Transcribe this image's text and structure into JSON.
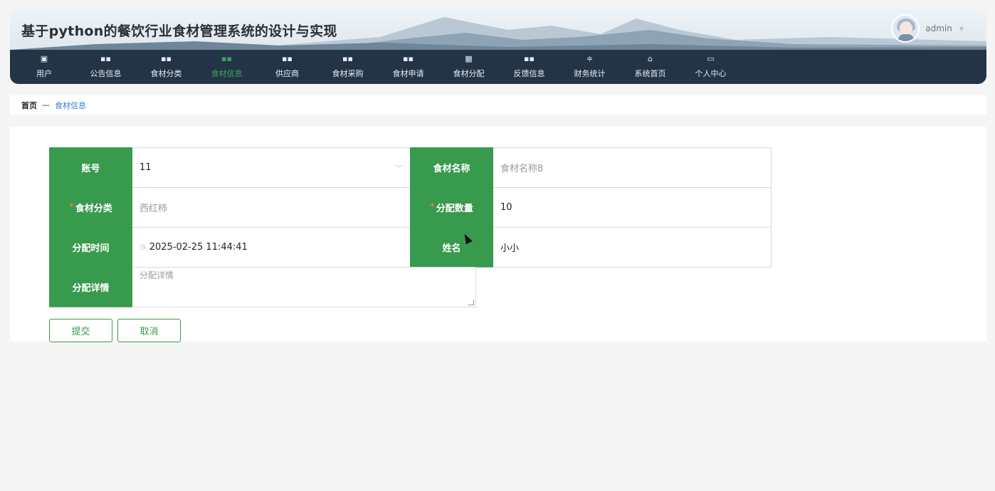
{
  "header": {
    "title": "基于python的餐饮行业食材管理系统的设计与实现",
    "user_name": "admin"
  },
  "nav": {
    "items": [
      {
        "label": "用户",
        "icon": "clipboard-icon"
      },
      {
        "label": "公告信息",
        "icon": "grid-icon"
      },
      {
        "label": "食材分类",
        "icon": "grid-icon"
      },
      {
        "label": "食材信息",
        "icon": "grid-icon",
        "active": true
      },
      {
        "label": "供应商",
        "icon": "grid-icon"
      },
      {
        "label": "食材采购",
        "icon": "grid-icon"
      },
      {
        "label": "食材申请",
        "icon": "grid-icon"
      },
      {
        "label": "食材分配",
        "icon": "table-icon"
      },
      {
        "label": "反馈信息",
        "icon": "grid-icon"
      },
      {
        "label": "财务统计",
        "icon": "sliders-icon"
      },
      {
        "label": "系统首页",
        "icon": "home-icon"
      },
      {
        "label": "个人中心",
        "icon": "card-icon"
      }
    ]
  },
  "breadcrumb": {
    "home": "首页",
    "separator": "—",
    "current": "食材信息"
  },
  "form": {
    "account_label": "账号",
    "account_value": "11",
    "food_name_label": "食材名称",
    "food_name_placeholder": "食材名称8",
    "category_label": "食材分类",
    "category_placeholder": "西红柿",
    "quantity_label": "分配数量",
    "quantity_value": "10",
    "time_label": "分配时间",
    "time_value": "2025-02-25 11:44:41",
    "name_label": "姓名",
    "name_value": "小小",
    "detail_label": "分配详情",
    "detail_placeholder": "分配详情",
    "required_mark": "*"
  },
  "buttons": {
    "submit": "提交",
    "cancel": "取消"
  },
  "colors": {
    "accent": "#379a4d",
    "nav_bg": "#243447",
    "link": "#2f7fd6"
  }
}
